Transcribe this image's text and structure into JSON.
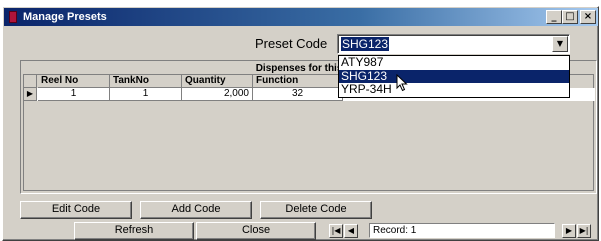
{
  "window": {
    "title": "Manage Presets",
    "controls": [
      "minimize-icon",
      "maximize-icon",
      "close-icon"
    ],
    "colors": {
      "titlebar_start": "#0a246a",
      "titlebar_end": "#a6caf0",
      "face": "#d4d0c8",
      "highlight": "#0a246a"
    }
  },
  "preset": {
    "label": "Preset Code",
    "value": "SHG123",
    "options": [
      "ATY987",
      "SHG123",
      "YRP-34H"
    ],
    "highlighted": "SHG123"
  },
  "dispenses": {
    "title": "Dispenses for this Pre",
    "columns": [
      "Reel No",
      "TankNo",
      "Quantity",
      "Function"
    ],
    "rows": [
      {
        "reel_no": "1",
        "tank_no": "1",
        "quantity": "2,000",
        "function": "32"
      }
    ]
  },
  "buttons": {
    "edit_code": "Edit Code",
    "add_code": "Add Code",
    "delete_code": "Delete Code",
    "refresh": "Refresh",
    "close": "Close"
  },
  "navigation": {
    "record": "Record: 1"
  }
}
